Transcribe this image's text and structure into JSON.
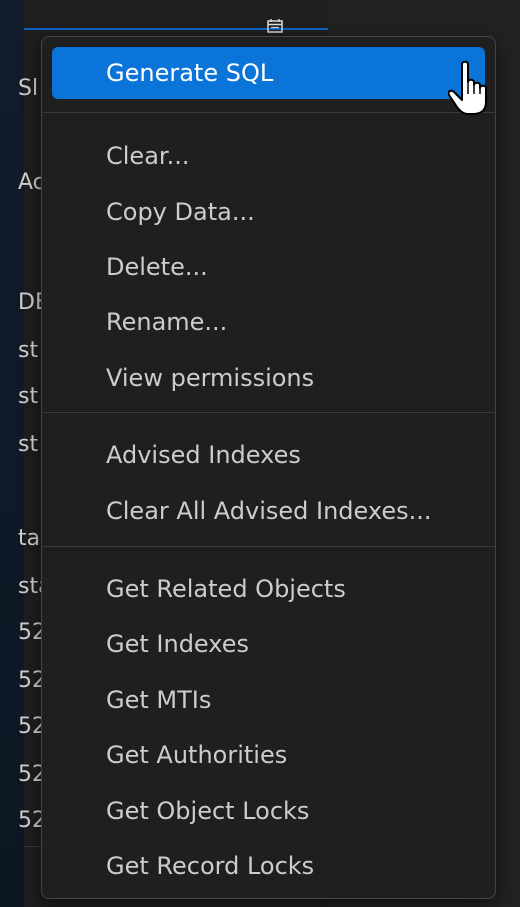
{
  "context_menu": {
    "items": [
      {
        "label": "Generate SQL"
      },
      {
        "label": "Clear..."
      },
      {
        "label": "Copy Data..."
      },
      {
        "label": "Delete..."
      },
      {
        "label": "Rename..."
      },
      {
        "label": "View permissions"
      },
      {
        "label": "Advised Indexes"
      },
      {
        "label": "Clear All Advised Indexes..."
      },
      {
        "label": "Get Related Objects"
      },
      {
        "label": "Get Indexes"
      },
      {
        "label": "Get MTIs"
      },
      {
        "label": "Get Authorities"
      },
      {
        "label": "Get Object Locks"
      },
      {
        "label": "Get Record Locks"
      }
    ],
    "highlighted_item": "Generate SQL"
  },
  "background_fragments": [
    "Sl",
    "Ac",
    "DE",
    "st",
    "st",
    "st",
    "ta",
    "sta",
    "52",
    "52",
    "52",
    "52",
    "52"
  ],
  "icons": {
    "calendar": "calendar-icon",
    "cursor": "hand-pointer-cursor-icon"
  },
  "colors": {
    "accent": "#0a74d9",
    "menu_background": "#1f1f1f",
    "menu_text": "#cccccc",
    "focus_border": "#0e63c6"
  }
}
